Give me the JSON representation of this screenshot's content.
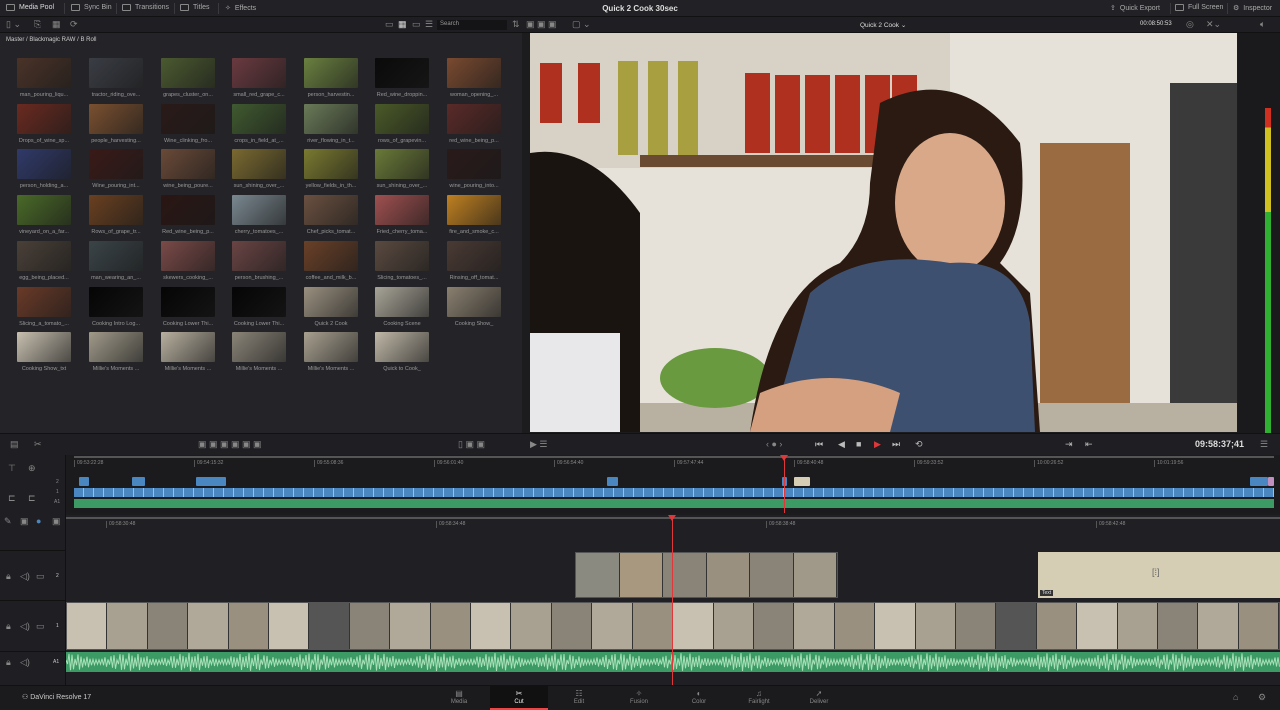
{
  "topbar": {
    "media_pool": "Media Pool",
    "sync_bin": "Sync Bin",
    "transitions": "Transitions",
    "titles": "Titles",
    "effects": "Effects",
    "project_title": "Quick 2 Cook 30sec",
    "quick_export": "Quick Export",
    "full_screen": "Full Screen",
    "inspector": "Inspector"
  },
  "toolbar2": {
    "search_placeholder": "Search",
    "timeline_name": "Quick 2 Cook",
    "timeline_name_chevron": "⌄",
    "duration": "00:08:50:53"
  },
  "media_pool": {
    "breadcrumb": "Master / Blackmagic RAW / B Roll",
    "clips": [
      {
        "name": "man_pouring_liqu...",
        "tint": "#4a3328"
      },
      {
        "name": "tractor_riding_ove...",
        "tint": "#3a3d44"
      },
      {
        "name": "grapes_cluster_on...",
        "tint": "#4b5a30"
      },
      {
        "name": "small_red_grape_c...",
        "tint": "#6a3a40"
      },
      {
        "name": "person_harvestin...",
        "tint": "#6a8040"
      },
      {
        "name": "Red_wine_droppin...",
        "tint": "#0a0a0a"
      },
      {
        "name": "woman_opening_...",
        "tint": "#7a4a30"
      },
      {
        "name": "Drops_of_wine_sp...",
        "tint": "#6a2a20"
      },
      {
        "name": "people_harvesting...",
        "tint": "#7a5030"
      },
      {
        "name": "Wine_clinking_fro...",
        "tint": "#2a1a18"
      },
      {
        "name": "crops_in_field_at_...",
        "tint": "#405a30"
      },
      {
        "name": "river_flowing_in_t...",
        "tint": "#6a7a58"
      },
      {
        "name": "rows_of_grapevin...",
        "tint": "#4a5a28"
      },
      {
        "name": "red_wine_being_p...",
        "tint": "#5a2a28"
      },
      {
        "name": "person_holding_a...",
        "tint": "#303a6a"
      },
      {
        "name": "Wine_pouring_int...",
        "tint": "#3a1a18"
      },
      {
        "name": "wine_being_poure...",
        "tint": "#6a4a38"
      },
      {
        "name": "sun_shining_over_...",
        "tint": "#7a6a30"
      },
      {
        "name": "yellow_fields_in_th...",
        "tint": "#7a7a30"
      },
      {
        "name": "sun_shining_over_...",
        "tint": "#6a7a38"
      },
      {
        "name": "wine_pouring_into...",
        "tint": "#2a1a1a"
      },
      {
        "name": "vineyard_on_a_far...",
        "tint": "#4a6a28"
      },
      {
        "name": "Rows_of_grape_tr...",
        "tint": "#6a4020"
      },
      {
        "name": "Red_wine_being_p...",
        "tint": "#2a1614"
      },
      {
        "name": "cherry_tomatoes_...",
        "tint": "#7a8890"
      },
      {
        "name": "Chef_picks_tomat...",
        "tint": "#6a5040"
      },
      {
        "name": "Fried_cherry_toma...",
        "tint": "#a05050"
      },
      {
        "name": "fire_and_smoke_c...",
        "tint": "#c08020"
      },
      {
        "name": "egg_being_placed...",
        "tint": "#4a4038"
      },
      {
        "name": "man_wearing_an_...",
        "tint": "#3a4448"
      },
      {
        "name": "skewers_cooking_...",
        "tint": "#7a4a48"
      },
      {
        "name": "person_brushing_...",
        "tint": "#6a4444"
      },
      {
        "name": "coffee_and_milk_b...",
        "tint": "#6a4028"
      },
      {
        "name": "Slicing_tomatoes_...",
        "tint": "#5a4a40"
      },
      {
        "name": "Rinsing_off_tomat...",
        "tint": "#4a3a34"
      },
      {
        "name": "Slicing_a_tomato_...",
        "tint": "#6a3a28"
      },
      {
        "name": "Cooking Intro Log...",
        "tint": "#050505"
      },
      {
        "name": "Cooking Lower Thi...",
        "tint": "#050505"
      },
      {
        "name": "Cooking Lower Thi...",
        "tint": "#050505"
      },
      {
        "name": "Quick 2 Cook",
        "tint": "#9a9080"
      },
      {
        "name": "Cooking Scene",
        "tint": "#a8a498"
      },
      {
        "name": "Cooking Show_",
        "tint": "#8a8070"
      },
      {
        "name": "Cooking Show_txt",
        "tint": "#c8c0b0"
      },
      {
        "name": "Millie's Moments ...",
        "tint": "#a09a8a"
      },
      {
        "name": "Millie's Moments ...",
        "tint": "#b8b0a0"
      },
      {
        "name": "Millie's Moments ...",
        "tint": "#8a8478"
      },
      {
        "name": "Millie's Moments ...",
        "tint": "#a8a090"
      },
      {
        "name": "Quick to Cook_",
        "tint": "#c0b8a8"
      }
    ]
  },
  "transport": {
    "timecode": "09:58:37;41"
  },
  "timeline_overview": {
    "ticks": [
      "09:53:22:28",
      "09:54:15:32",
      "09:55:08:36",
      "09:56:01:40",
      "09:56:54:40",
      "09:57:47:44",
      "09:58:40:48",
      "09:59:33:52",
      "10:00:26:52",
      "10:01:19:56"
    ],
    "track_labels": [
      "2",
      "1",
      "A1"
    ]
  },
  "timeline_detail": {
    "ticks": [
      "09:58:30:48",
      "09:58:34:48",
      "09:58:38:48",
      "09:58:42:48"
    ],
    "tracks": [
      "2",
      "1",
      "A1"
    ],
    "text_clip_label": "Text"
  },
  "colors": {
    "video_clip": "#4a87c0",
    "audio_clip": "#3c9a64",
    "playhead": "#e0383a",
    "title_clip": "#d6ceb4"
  },
  "pages": [
    {
      "label": "Media",
      "icon": "▤"
    },
    {
      "label": "Cut",
      "icon": "✂"
    },
    {
      "label": "Edit",
      "icon": "☷"
    },
    {
      "label": "Fusion",
      "icon": "✧"
    },
    {
      "label": "Color",
      "icon": "◐"
    },
    {
      "label": "Fairlight",
      "icon": "♫"
    },
    {
      "label": "Deliver",
      "icon": "➚"
    }
  ],
  "app_name": "DaVinci Resolve 17"
}
